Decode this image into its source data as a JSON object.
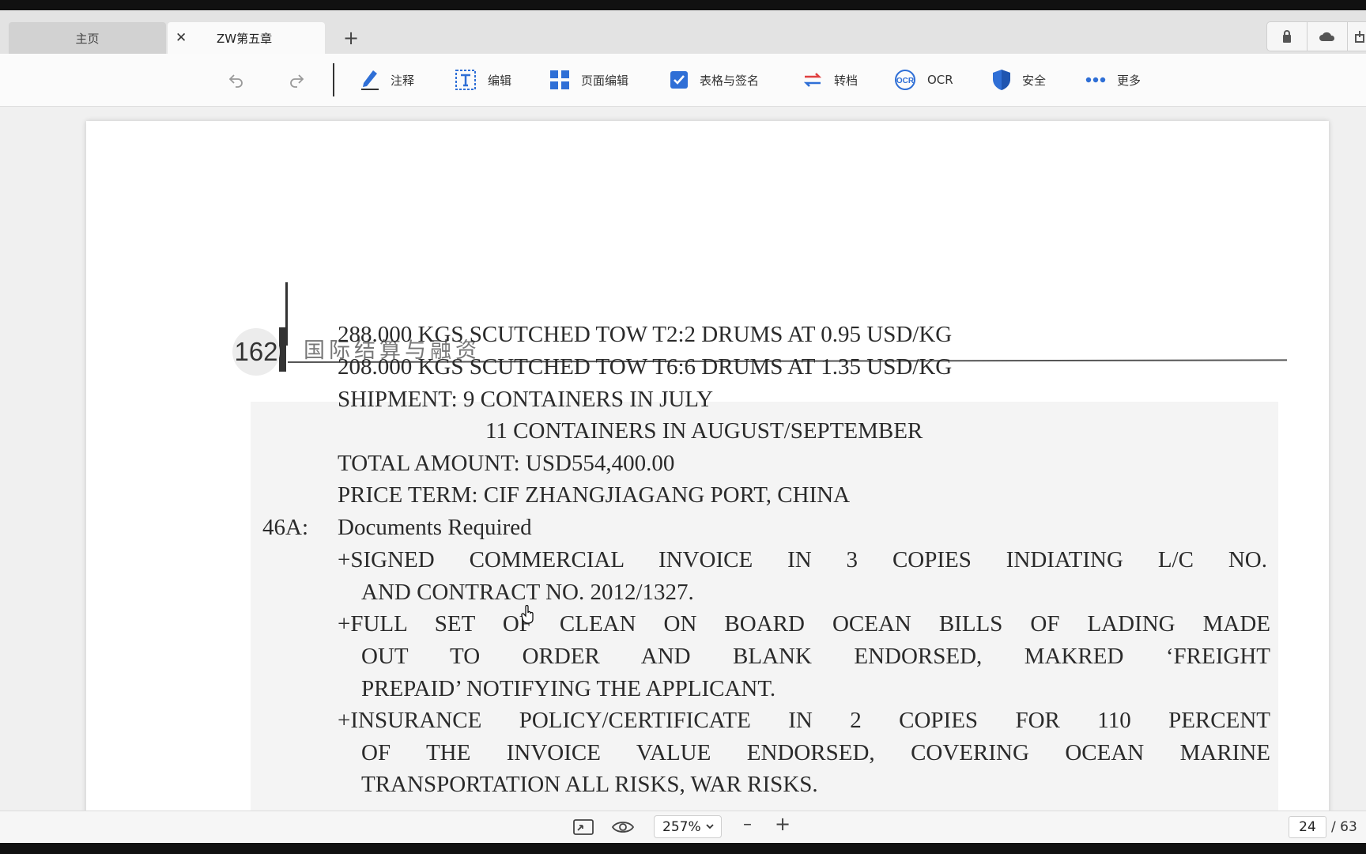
{
  "tabs": {
    "home": "主页",
    "close": "✕",
    "document": "ZW第五章",
    "add": "+"
  },
  "toolbar": {
    "annotate": "注释",
    "edit": "编辑",
    "page_edit": "页面编辑",
    "forms_sign": "表格与签名",
    "convert": "转档",
    "ocr": "OCR",
    "security": "安全",
    "more": "更多"
  },
  "document": {
    "page_number": "162",
    "running_head": "国际结算与融资",
    "lines": [
      "288.000 KGS SCUTCHED TOW T2:2 DRUMS AT 0.95 USD/KG",
      "208.000 KGS SCUTCHED TOW T6:6 DRUMS AT 1.35 USD/KG",
      "SHIPMENT: 9 CONTAINERS IN JULY",
      "11 CONTAINERS IN AUGUST/SEPTEMBER",
      "TOTAL AMOUNT: USD554,400.00",
      "PRICE TERM: CIF ZHANGJIAGANG PORT, CHINA",
      "46A:",
      "Documents Required",
      "+SIGNED COMMERCIAL INVOICE IN 3 COPIES INDIATING L/C NO.",
      "AND CONTRACT NO. 2012/1327.",
      "+FULL SET OF CLEAN ON BOARD OCEAN BILLS OF LADING MADE",
      "OUT TO ORDER AND BLANK ENDORSED, MAKRED ‘FREIGHT",
      "PREPAID’ NOTIFYING THE APPLICANT.",
      "+INSURANCE POLICY/CERTIFICATE IN 2 COPIES FOR 110 PERCENT",
      "OF THE INVOICE VALUE ENDORSED, COVERING OCEAN MARINE",
      "TRANSPORTATION ALL RISKS, WAR RISKS."
    ]
  },
  "statusbar": {
    "zoom": "257%",
    "zoom_minus": "–",
    "zoom_plus": "+",
    "current_page": "24",
    "total_pages": "/ 63"
  },
  "icons": {
    "annotate": "pen-icon",
    "edit": "text-edit-icon",
    "page_edit": "grid-icon",
    "forms_sign": "checkbox-icon",
    "convert": "convert-arrows-icon",
    "ocr": "ocr-icon",
    "security": "shield-icon",
    "more": "dots-icon"
  },
  "colors": {
    "accent": "#2f6fd6",
    "convert": "#e04040"
  }
}
